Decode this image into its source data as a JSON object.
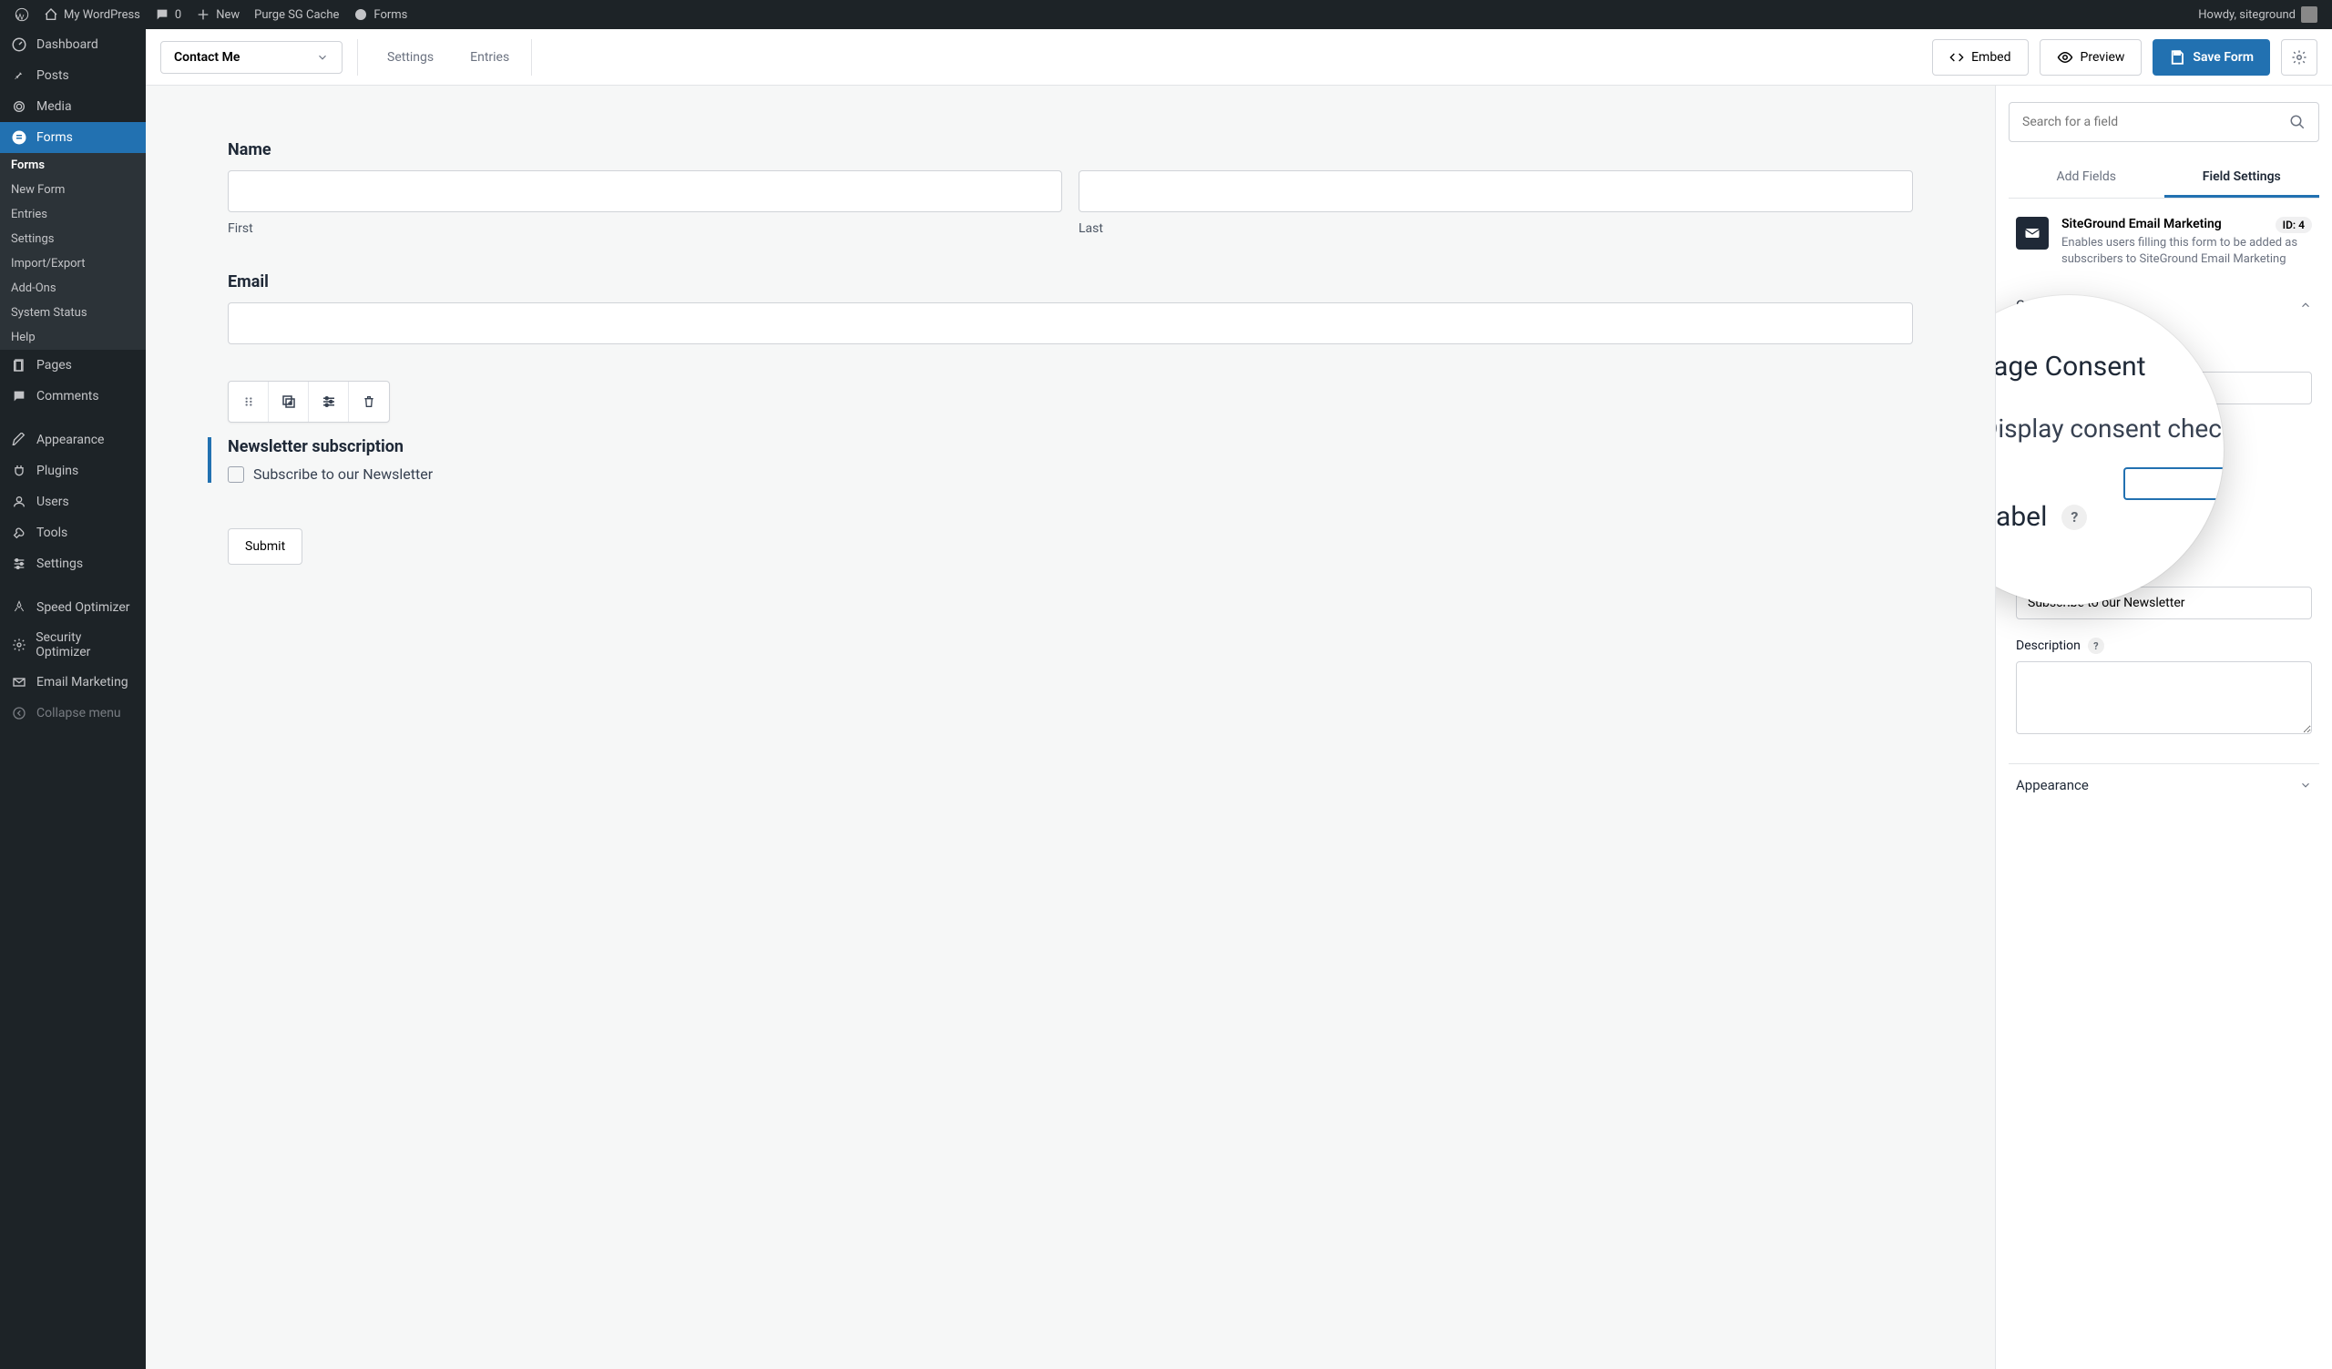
{
  "topbar": {
    "site": "My WordPress",
    "comments_count": "0",
    "new_label": "New",
    "purge_label": "Purge SG Cache",
    "forms_label": "Forms",
    "greeting": "Howdy, siteground"
  },
  "sidebar": {
    "dashboard": "Dashboard",
    "posts": "Posts",
    "media": "Media",
    "forms": "Forms",
    "sub": {
      "forms": "Forms",
      "new_form": "New Form",
      "entries": "Entries",
      "settings": "Settings",
      "import_export": "Import/Export",
      "addons": "Add-Ons",
      "system_status": "System Status",
      "help": "Help"
    },
    "pages": "Pages",
    "comments": "Comments",
    "appearance": "Appearance",
    "plugins": "Plugins",
    "users": "Users",
    "tools": "Tools",
    "settings": "Settings",
    "speed_opt": "Speed Optimizer",
    "security_opt": "Security Optimizer",
    "email_mkt": "Email Marketing",
    "collapse": "Collapse menu"
  },
  "form_header": {
    "selected_form": "Contact Me",
    "tab_settings": "Settings",
    "tab_entries": "Entries",
    "embed_btn": "Embed",
    "preview_btn": "Preview",
    "save_btn": "Save Form"
  },
  "canvas": {
    "name_label": "Name",
    "name_first": "First",
    "name_last": "Last",
    "email_label": "Email",
    "newsletter_title": "Newsletter subscription",
    "newsletter_check": "Subscribe to our Newsletter",
    "submit_label": "Submit"
  },
  "panel": {
    "search_placeholder": "Search for a field",
    "tab_add": "Add Fields",
    "tab_settings": "Field Settings",
    "field_title": "SiteGround Email Marketing",
    "field_id": "ID: 4",
    "field_desc": "Enables users filling this form to be added as subscribers to SiteGround Email Marketing",
    "section_general": "General",
    "section_appearance": "Appearance",
    "checkbox_label_setting": "Subscribe to our Newsletter",
    "description_label": "Description"
  },
  "zoom": {
    "consent_title": "Manage Consent",
    "check_label": "Display consent chec",
    "field_label": "ield Label"
  }
}
